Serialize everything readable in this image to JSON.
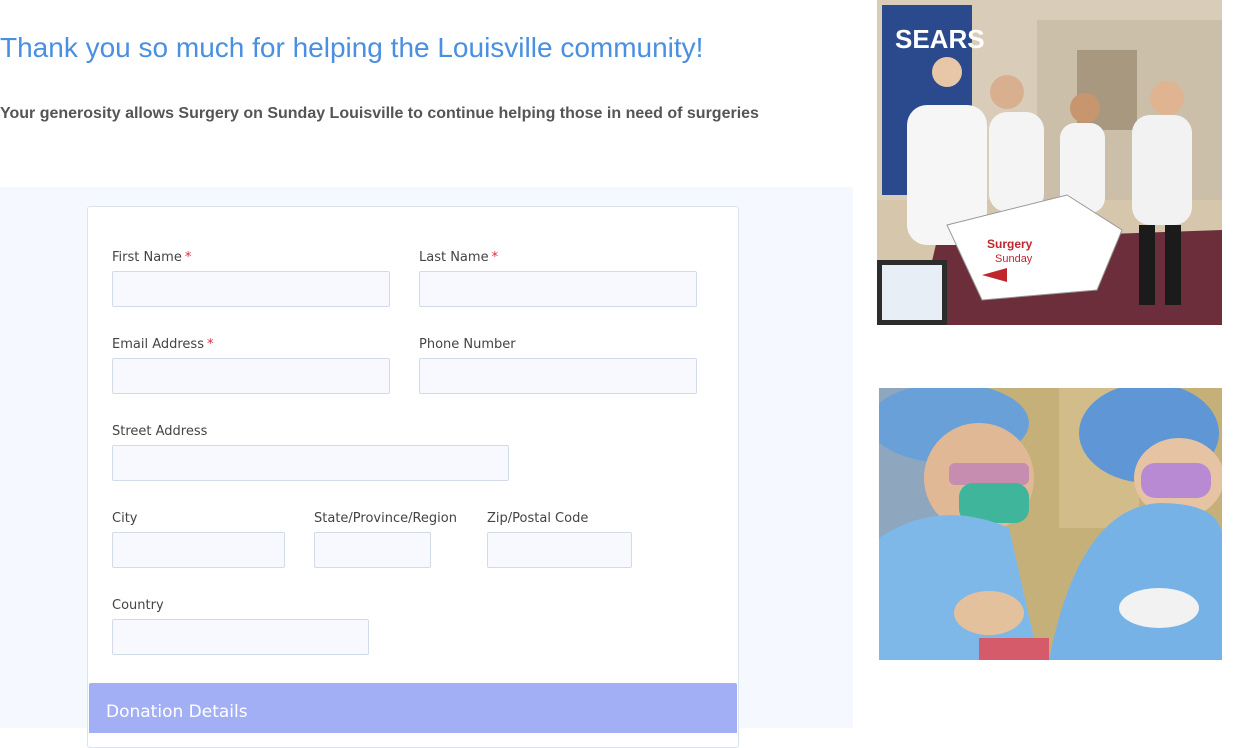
{
  "page": {
    "heading": "Thank you so much for helping the Louisville community!",
    "subheading": "Your generosity allows Surgery on Sunday Louisville to continue helping those in need of surgeries"
  },
  "form": {
    "required_mark": "*",
    "fields": {
      "first_name": {
        "label": "First Name",
        "value": ""
      },
      "last_name": {
        "label": "Last Name",
        "value": ""
      },
      "email": {
        "label": "Email Address",
        "value": ""
      },
      "phone": {
        "label": "Phone Number",
        "value": ""
      },
      "street": {
        "label": "Street Address",
        "value": ""
      },
      "city": {
        "label": "City",
        "value": ""
      },
      "state": {
        "label": "State/Province/Region",
        "value": ""
      },
      "zip": {
        "label": "Zip/Postal Code",
        "value": ""
      },
      "country": {
        "label": "Country",
        "value": ""
      }
    },
    "donation_section_title": "Donation Details"
  },
  "photos": {
    "volunteers": {
      "sign_text": "SEARS",
      "box_text_1": "Surgery",
      "box_text_2": "Sunday"
    },
    "surgeons": {}
  },
  "colors": {
    "heading": "#4a8fe0",
    "required": "#e0283b",
    "section_bar": "#a3aff5",
    "form_background": "#f5f8ff"
  }
}
